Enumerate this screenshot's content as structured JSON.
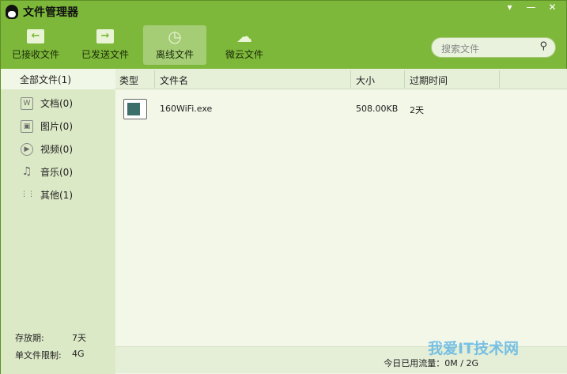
{
  "window": {
    "title": "文件管理器",
    "controls": [
      "▾",
      "—",
      "✕"
    ]
  },
  "toolbar": [
    {
      "label": "已接收文件",
      "icon": "folder-arrow-left-icon"
    },
    {
      "label": "已发送文件",
      "icon": "folder-arrow-right-icon"
    },
    {
      "label": "离线文件",
      "icon": "clock-icon",
      "active": true
    },
    {
      "label": "微云文件",
      "icon": "cloud-icon"
    }
  ],
  "search": {
    "placeholder": "搜索文件"
  },
  "sidebar": {
    "all": "全部文件(1)",
    "items": [
      {
        "label": "文档(0)",
        "icon": "W"
      },
      {
        "label": "图片(0)",
        "icon": "▣"
      },
      {
        "label": "视频(0)",
        "icon": "▶"
      },
      {
        "label": "音乐(0)",
        "icon": "♫"
      },
      {
        "label": "其他(1)",
        "icon": "⋮⋮"
      }
    ],
    "retention_label": "存放期:",
    "retention_value": "7天",
    "limit_label": "单文件限制:",
    "limit_value": "4G"
  },
  "table": {
    "headers": [
      "类型",
      "文件名",
      "大小",
      "过期时间"
    ],
    "rows": [
      {
        "name": "160WiFi.exe",
        "size": "508.00KB",
        "expires": "2天"
      }
    ]
  },
  "status": {
    "usage": "今日已用流量：0M / 2G"
  },
  "watermark": "我爱IT技术网"
}
